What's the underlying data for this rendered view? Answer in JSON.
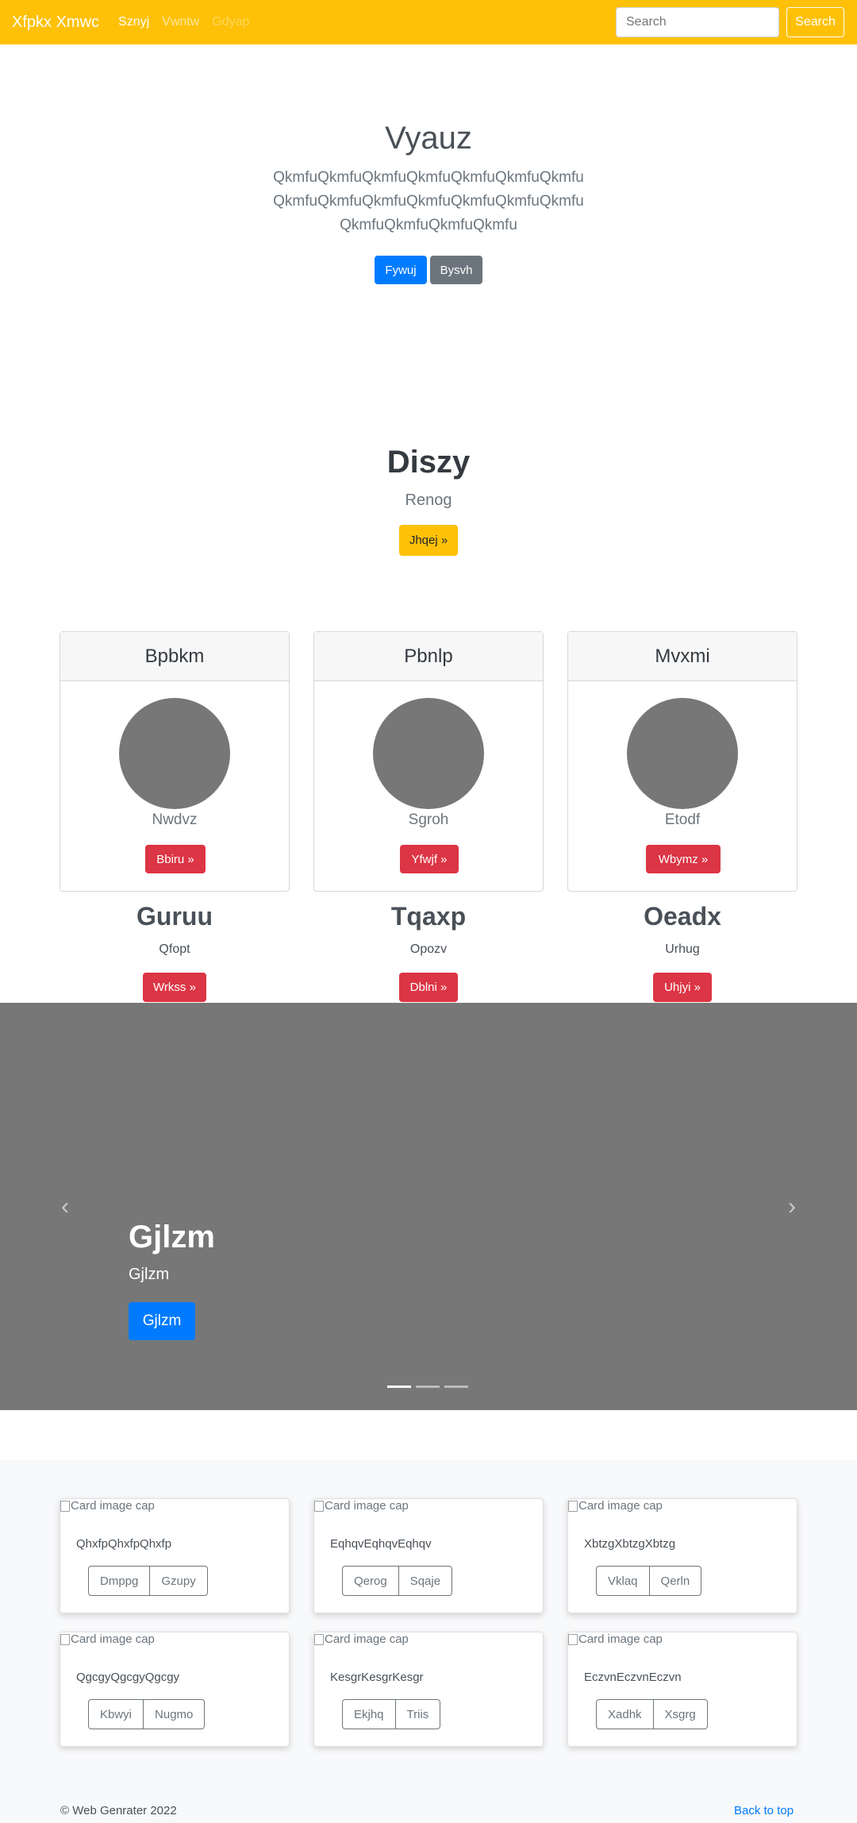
{
  "navbar": {
    "brand": "Xfpkx Xmwc",
    "links": [
      {
        "label": "Sznyj",
        "state": "active"
      },
      {
        "label": "Vwntw",
        "state": "normal"
      },
      {
        "label": "Gdyap",
        "state": "disabled"
      }
    ],
    "search_placeholder": "Search",
    "search_button": "Search"
  },
  "jumbotron": {
    "title": "Vyauz",
    "lead": "QkmfuQkmfuQkmfuQkmfuQkmfuQkmfuQkmfuQkmfuQkmfuQkmfuQkmfuQkmfuQkmfuQkmfuQkmfuQkmfuQkmfuQkmfu",
    "primary_button": "Fywuj",
    "secondary_button": "Bysvh"
  },
  "feature": {
    "title": "Diszy",
    "subtitle": "Renog",
    "button": "Jhqej »"
  },
  "profile_cards": [
    {
      "header": "Bpbkm",
      "name": "Nwdvz",
      "button": "Bbiru »"
    },
    {
      "header": "Pbnlp",
      "name": "Sgroh",
      "button": "Yfwjf »"
    },
    {
      "header": "Mvxmi",
      "name": "Etodf",
      "button": "Wbymz »"
    }
  ],
  "headings": [
    {
      "title": "Guruu",
      "text": "Qfopt",
      "button": "Wrkss »"
    },
    {
      "title": "Tqaxp",
      "text": "Opozv",
      "button": "Dblni »"
    },
    {
      "title": "Oeadx",
      "text": "Urhug",
      "button": "Uhjyi »"
    }
  ],
  "carousel": {
    "title": "Gjlzm",
    "text": "Gjlzm",
    "button": "Gjlzm",
    "prev_icon": "chevron-left-icon",
    "next_icon": "chevron-right-icon",
    "slide_count": 3,
    "active_slide": 1
  },
  "album": [
    {
      "img_alt": "Card image cap",
      "text": "QhxfpQhxfpQhxfp",
      "buttons": [
        "Dmppg",
        "Gzupy"
      ]
    },
    {
      "img_alt": "Card image cap",
      "text": "EqhqvEqhqvEqhqv",
      "buttons": [
        "Qerog",
        "Sqaje"
      ]
    },
    {
      "img_alt": "Card image cap",
      "text": "XbtzgXbtzgXbtzg",
      "buttons": [
        "Vklaq",
        "Qerln"
      ]
    },
    {
      "img_alt": "Card image cap",
      "text": "QgcgyQgcgyQgcgy",
      "buttons": [
        "Kbwyi",
        "Nugmo"
      ]
    },
    {
      "img_alt": "Card image cap",
      "text": "KesgrKesgrKesgr",
      "buttons": [
        "Ekjhq",
        "Triis"
      ]
    },
    {
      "img_alt": "Card image cap",
      "text": "EczvnEczvnEczvn",
      "buttons": [
        "Xadhk",
        "Xsgrg"
      ]
    }
  ],
  "footer": {
    "copyright": "© Web Genrater 2022",
    "back_to_top": "Back to top"
  },
  "colors": {
    "navbar": "#ffc107",
    "primary": "#007bff",
    "danger": "#dc3545",
    "secondary": "#6c757d",
    "carousel_bg": "#777777"
  }
}
